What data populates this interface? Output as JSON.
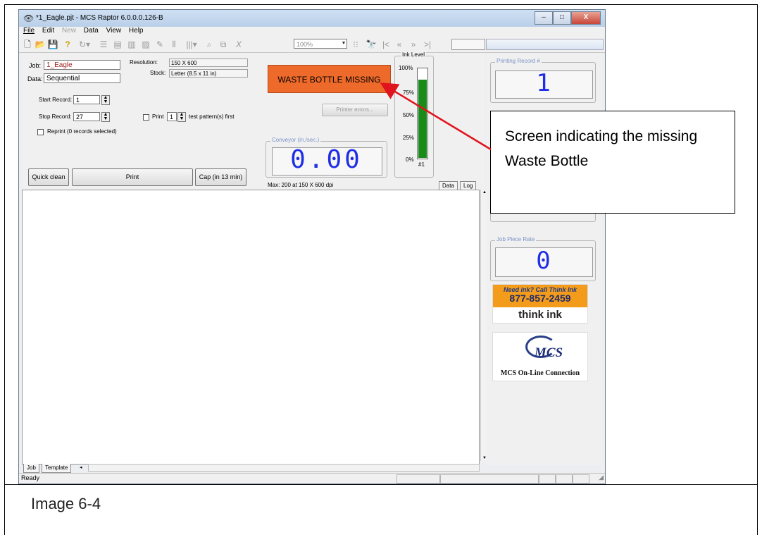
{
  "window": {
    "title": "*1_Eagle.pjt - MCS Raptor 6.0.0.0.126-B",
    "buttons": {
      "minimize": "–",
      "maximize": "□",
      "close": "X"
    }
  },
  "menu": [
    "File",
    "Edit",
    "New",
    "Data",
    "View",
    "Help"
  ],
  "toolbar": {
    "zoom": "100%"
  },
  "job": {
    "job_label": "Job:",
    "job_value": "1_Eagle",
    "data_label": "Data:",
    "data_value": "Sequential",
    "resolution_label": "Resolution:",
    "resolution_value": "150 X 600",
    "stock_label": "Stock:",
    "stock_value": "Letter (8.5 x 11 in)",
    "start_label": "Start Record:",
    "start_value": "1",
    "stop_label": "Stop Record:",
    "stop_value": "27",
    "print_label": "Print",
    "print_value": "1",
    "test_label": "test pattern(s) first",
    "reprint_label": "Reprint (0 records selected)"
  },
  "buttons": {
    "quick_clean": "Quick clean",
    "print": "Print",
    "cap": "Cap (in 13 min)",
    "printer_errors": "Printer errors..."
  },
  "alert": "WASTE BOTTLE MISSING",
  "conveyor": {
    "title": "Conveyor (in./sec.)",
    "value": "0.00",
    "max": "Max: 200 at 150 X 600 dpi"
  },
  "ink": {
    "title": "Ink Level",
    "scale": [
      "100%",
      "75%",
      "50%",
      "25%",
      "0%"
    ],
    "level": 0.88,
    "cartridge": "#1",
    "fill_color": "#1a8b1a"
  },
  "right": {
    "printing_record_title": "Printing Record #",
    "printing_record_value": "1",
    "piece_rate_title": "Job Piece Rate",
    "piece_rate_value": "0"
  },
  "tabs": {
    "data": "Data",
    "log": "Log",
    "job": "Job",
    "template": "Template"
  },
  "status": "Ready",
  "ads": {
    "ink_line1": "Need ink? Call Think Ink",
    "ink_phone": "877-857-2459",
    "ink_brand": "think ink",
    "mcs_logo": "MCS",
    "mcs_caption": "MCS On-Line Connection"
  },
  "callout": {
    "text": "Screen indicating the missing Waste Bottle"
  },
  "caption": "Image 6-4",
  "colors": {
    "alert": "#ee6a2a",
    "digits": "#1f2ee6",
    "arrow": "#e0141e"
  }
}
